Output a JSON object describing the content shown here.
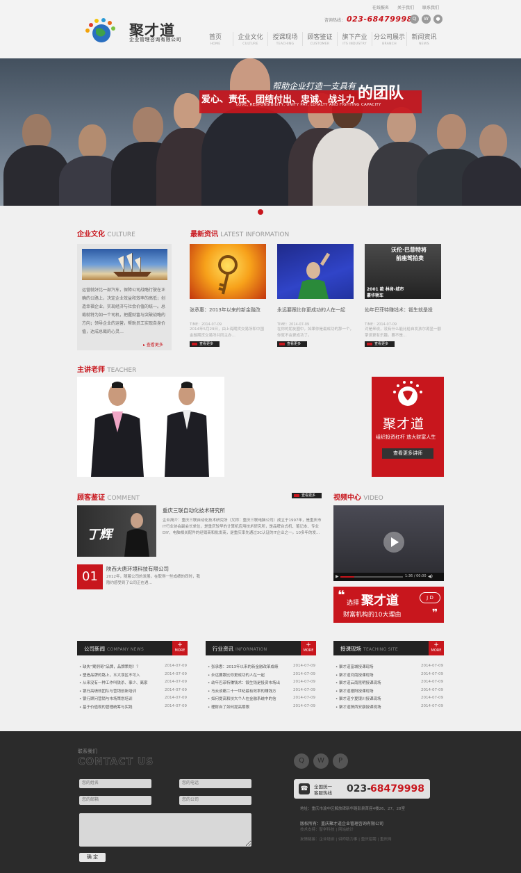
{
  "header": {
    "top_links": [
      "在线报名",
      "关于我们",
      "联系我们"
    ],
    "hotline_label": "咨询热线：",
    "hotline_number": "023-68479998",
    "logo_name": "聚才道",
    "logo_sub": "企业管理咨询有限公司",
    "nav": [
      {
        "cn": "首页",
        "en": "HOME"
      },
      {
        "cn": "企业文化",
        "en": "CULTURE"
      },
      {
        "cn": "授课现场",
        "en": "TEACHING"
      },
      {
        "cn": "顾客鉴证",
        "en": "CUSTOMER"
      },
      {
        "cn": "旗下产业",
        "en": "ITS INDUSTRY"
      },
      {
        "cn": "分公司展示",
        "en": "BRANCH"
      },
      {
        "cn": "新闻资讯",
        "en": "NEWS"
      }
    ]
  },
  "banner": {
    "line1": "帮助企业打造一支具有",
    "line2": "爱心、责任、团结付出、忠诚、战斗力",
    "big": "的团队",
    "en": "LOVE, RESPONSIBILITY, UNITY PAY, LOYALTY AND FIGHTING CAPACITY"
  },
  "culture": {
    "title_cn": "企业文化",
    "title_en": "CULTURE",
    "text": "运营就好比一部汽车，保障公司战略行驶在正确的公路上，决定企业效益和效率的高低；创造幸福企业，实现经济与社会价值的统一。总裁就特为如一个司机，把握财富与突破战略的方向；领导企业的运营，帮助员工实现自身价值，达成总裁的心灵…",
    "more": "查看更多"
  },
  "news": {
    "title_cn": "最新资讯",
    "title_en": "LATEST INFORMATION",
    "items": [
      {
        "title": "张承惠：2013年以来的新金融改",
        "time": "TIME：2014-07-09",
        "desc": "2014年5月29日，由上海期货交易所和中国金融期货交易所共同主办…",
        "more": "查看更多"
      },
      {
        "title": "永远要跟比你更成功的人在一起",
        "time": "TIME：2014-07-09",
        "desc": "在你的朋友圈中，如果你是最成功的那一个，你就不会更成功了。",
        "more": "查看更多"
      },
      {
        "title": "幼年巴菲特赚钱术：锻生就是投",
        "time": "TIME：2014-07-09",
        "desc": "对是来说，没有什么能比给自发孩尔源显一额掌该更有乐趣。要不是…",
        "more": "查看更多"
      }
    ],
    "img2_text1": "沃伦·巴菲特将",
    "img2_text2": "前座驾拍卖",
    "img2_text3": "2001 款 林肯-城市",
    "img2_text4": "豪华轿车"
  },
  "teacher": {
    "title_cn": "主讲老师",
    "title_en": "TEACHER",
    "ad_name": "聚才道",
    "ad_slogan": "组织投资杠杆 放大财富人生",
    "ad_btn": "查看更多讲师"
  },
  "comment": {
    "title_cn": "顾客鉴证",
    "title_en": "COMMENT",
    "more": "查看更多",
    "c1_company": "重庆三联自动化技术研究所",
    "c1_desc": "企业简介：重庆三联自动化技术研究所（又称：重庆三联电脑公司）成立于1997年，是重庆市IT行业协会副会长单位，是重庆较早的计算机应用技术研究所，是品牌台式机、笔记本、专业DIY、电脑相关配件的经销商和批发商，是重庆率先通过3C认证的IT企业之一。10多年的发…",
    "c1_img_text": "丁辉",
    "badge": "01",
    "c2_company": "陕西大唐环境科技有限公司",
    "c2_desc": "2012年，随着公司的发展，在取得一些成绩的同时，我隐约感受到了公司正在遇…"
  },
  "video": {
    "title_cn": "视频中心",
    "title_en": "VIDEO",
    "time": "1:36 / 00:00",
    "ad_pick": "选择",
    "ad_name": "聚才道",
    "ad_reason": "财富机构的10大理由",
    "ad_jcd": "J D"
  },
  "lists": [
    {
      "title_cn": "公司新闻",
      "title_en": "COMPANY NEWS",
      "more": "MORE",
      "items": [
        {
          "title": "缺失“案例哥”品牌，品牌策划！？",
          "date": "2014-07-09"
        },
        {
          "title": "塑造品牌的路上，五大误区不可入",
          "date": "2014-07-09"
        },
        {
          "title": "从来没有一种工作叫铁杀、事少、离家",
          "date": "2014-07-09"
        },
        {
          "title": "银行高绩效团队与营销创新培训",
          "date": "2014-07-09"
        },
        {
          "title": "银行顾问营销与市场策划培训",
          "date": "2014-07-09"
        },
        {
          "title": "基于价值观的管理统筹与实践",
          "date": "2014-07-09"
        }
      ]
    },
    {
      "title_cn": "行业资讯",
      "title_en": "INFORMATION",
      "more": "MORE",
      "items": [
        {
          "title": "张承惠：2013年以来的新金融改革成绩",
          "date": "2014-07-09"
        },
        {
          "title": "永远要跟比你更成功的人在一起",
          "date": "2014-07-09"
        },
        {
          "title": "幼年巴菲特赚钱术：锻生钱是投资市场出",
          "date": "2014-07-09"
        },
        {
          "title": "马云谈霸二十一世纪最有效率的赚钱方",
          "date": "2014-07-09"
        },
        {
          "title": "如何提高和扶大个人在金融系统中的信",
          "date": "2014-07-09"
        },
        {
          "title": "理财自了如何提高期限",
          "date": "2014-07-09"
        }
      ]
    },
    {
      "title_cn": "授课现场",
      "title_en": "TEACHING SITE",
      "more": "MORE",
      "items": [
        {
          "title": "聚才道富城授课现场",
          "date": "2014-07-09"
        },
        {
          "title": "聚才道河南授课现场",
          "date": "2014-07-09"
        },
        {
          "title": "聚才道云南昆明授课现场",
          "date": "2014-07-09"
        },
        {
          "title": "聚才道德阳授课现场",
          "date": "2014-07-09"
        },
        {
          "title": "聚才道宁夏银川授课现场",
          "date": "2014-07-09"
        },
        {
          "title": "聚才道陕西安康授课现场",
          "date": "2014-07-09"
        }
      ]
    }
  ],
  "footer": {
    "contact_cn": "联系我们",
    "contact_en": "CONTACT US",
    "ph_name": "您的姓名",
    "ph_phone": "您的电话",
    "ph_email": "您的邮箱",
    "ph_company": "您的公司",
    "submit": "确 定",
    "hot_cn1": "全国统一",
    "hot_cn2": "客服热线",
    "num1": "023-",
    "num2": "68479998",
    "address": "地址：重庆市渝中区解放碑新华路彭泉首座4楼26、27、28室",
    "copyright": "版权所有：重庆聚才道企业管理咨询有限公司",
    "tech": "技术支持：智学科技 | 网站统计",
    "links": "友情链接：企业培训 | 讲师助力事 | 重庆招聘 | 重庆网"
  },
  "colors": {
    "accent": "#c8161d",
    "dark": "#222222",
    "footer": "#2b2b2b"
  }
}
